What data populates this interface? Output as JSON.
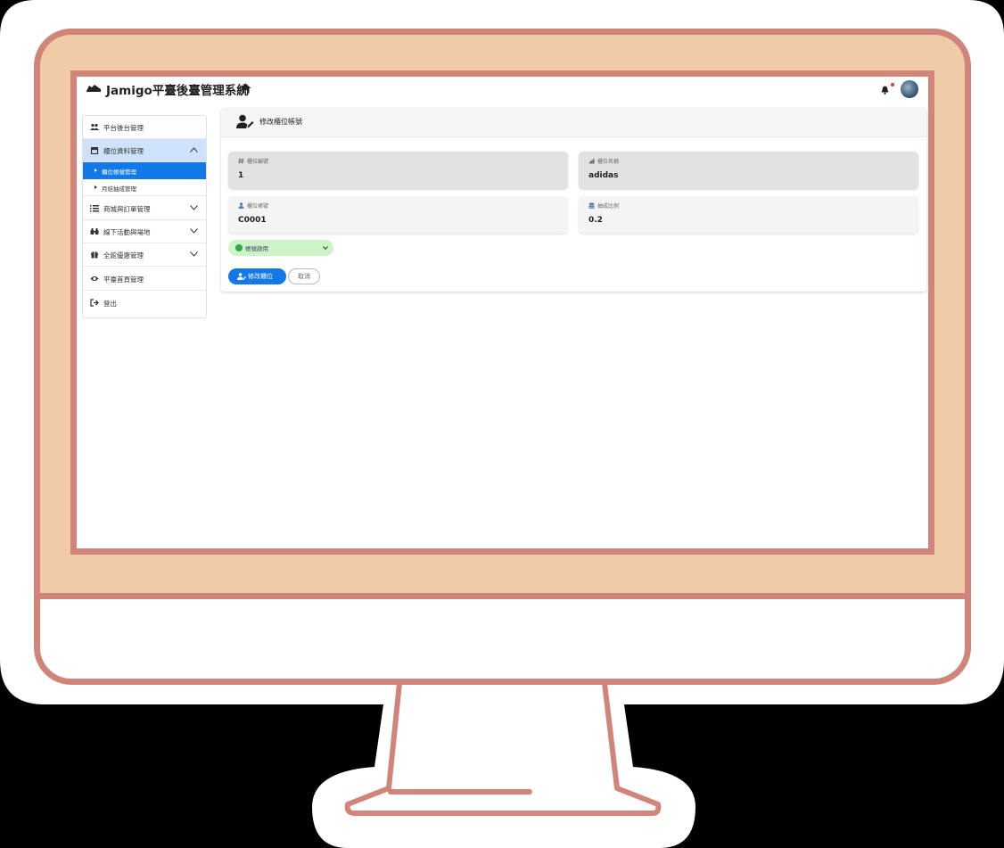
{
  "header": {
    "brand_title": "Jamigo平臺後臺管理系統",
    "brand_icon": "shoe-icon",
    "home_icon": "home-icon",
    "bell_icon": "bell-icon",
    "avatar": "user-avatar"
  },
  "sidebar": {
    "items": [
      {
        "label": "平台後台管理",
        "icon": "users-icon"
      },
      {
        "label": "櫃位資料管理",
        "icon": "store-icon",
        "expanded": true,
        "children": [
          {
            "label": "櫃位帳號管理",
            "active": true
          },
          {
            "label": "月結抽成管理",
            "active": false
          }
        ]
      },
      {
        "label": "商城與訂單管理",
        "icon": "list-icon"
      },
      {
        "label": "線下活動與場地",
        "icon": "binoculars-icon"
      },
      {
        "label": "全館優惠管理",
        "icon": "gift-icon"
      },
      {
        "label": "平臺首頁管理",
        "icon": "eye-icon"
      },
      {
        "label": "登出",
        "icon": "logout-icon"
      }
    ]
  },
  "main": {
    "title": "修改櫃位帳號",
    "fields": {
      "counter_id": {
        "label": "櫃位編號",
        "value": "1",
        "icon": "hash-icon"
      },
      "counter_name": {
        "label": "櫃位名稱",
        "value": "adidas",
        "icon": "brand-icon"
      },
      "counter_account": {
        "label": "櫃位帳號",
        "value": "C0001",
        "icon": "user-icon"
      },
      "commission_rate": {
        "label": "抽成比例",
        "value": "0.2",
        "icon": "coins-icon"
      }
    },
    "status_select": {
      "value": "帳號啟用"
    },
    "buttons": {
      "submit": "修改櫃位",
      "cancel": "取消"
    }
  },
  "colors": {
    "monitor_border": "#d1857a",
    "monitor_bezel": "#f0cba8",
    "primary": "#1479e8",
    "sidebar_open_bg": "#cfe2fb",
    "status_bg": "#cdf3c8"
  }
}
